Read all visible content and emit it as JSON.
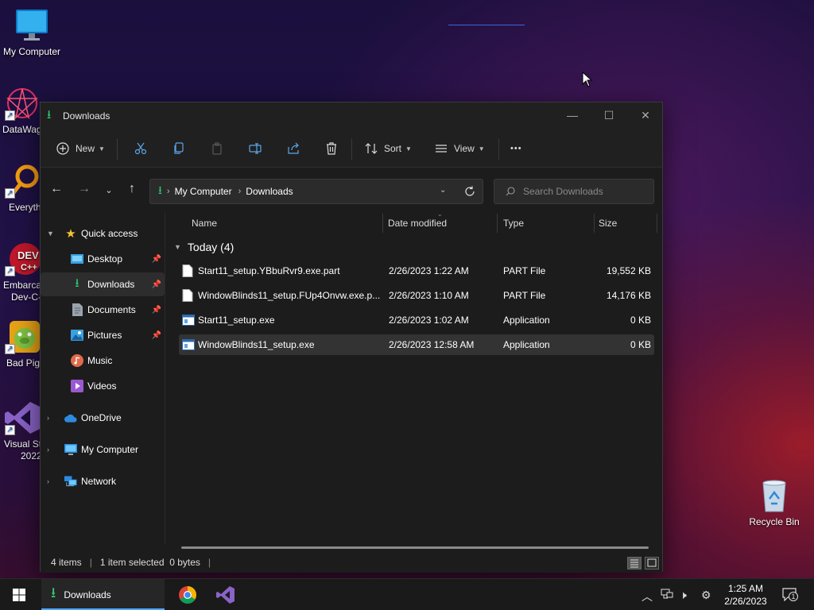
{
  "desktop": {
    "icons": [
      {
        "label": "My Computer"
      },
      {
        "label": "DataWag"
      },
      {
        "label": "Everyth"
      },
      {
        "label": "Embarca",
        "label2": "Dev-C-"
      },
      {
        "label": "Bad Pigi"
      },
      {
        "label": "Visual St",
        "label2": "2022"
      },
      {
        "label": "Recycle Bin"
      }
    ]
  },
  "window": {
    "title": "Downloads",
    "controls": {
      "minimize": "—",
      "maximize": "☐",
      "close": "✕"
    }
  },
  "toolbar": {
    "new_label": "New",
    "sort_label": "Sort",
    "view_label": "View",
    "more_label": "•••"
  },
  "address": {
    "crumbs": [
      "My Computer",
      "Downloads"
    ],
    "search_placeholder": "Search Downloads"
  },
  "nav": {
    "quick_access": "Quick access",
    "items": [
      {
        "label": "Desktop"
      },
      {
        "label": "Downloads"
      },
      {
        "label": "Documents"
      },
      {
        "label": "Pictures"
      },
      {
        "label": "Music"
      },
      {
        "label": "Videos"
      }
    ],
    "onedrive": "OneDrive",
    "my_computer": "My Computer",
    "network": "Network"
  },
  "columns": {
    "name": "Name",
    "date": "Date modified",
    "type": "Type",
    "size": "Size"
  },
  "group": {
    "label": "Today (4)"
  },
  "files": [
    {
      "name": "Start11_setup.YBbuRvr9.exe.part",
      "date": "2/26/2023 1:22 AM",
      "type": "PART File",
      "size": "19,552 KB"
    },
    {
      "name": "WindowBlinds11_setup.FUp4Onvw.exe.p...",
      "date": "2/26/2023 1:10 AM",
      "type": "PART File",
      "size": "14,176 KB"
    },
    {
      "name": "Start11_setup.exe",
      "date": "2/26/2023 1:02 AM",
      "type": "Application",
      "size": "0 KB"
    },
    {
      "name": "WindowBlinds11_setup.exe",
      "date": "2/26/2023 12:58 AM",
      "type": "Application",
      "size": "0 KB"
    }
  ],
  "status": {
    "count": "4 items",
    "selected": "1 item selected  0 bytes"
  },
  "taskbar": {
    "explorer_label": "Downloads",
    "time": "1:25 AM",
    "date": "2/26/2023",
    "notif_count": "1"
  },
  "colors": {
    "accent": "#2ecc71",
    "taskbar_active": "#4ea6ff"
  }
}
